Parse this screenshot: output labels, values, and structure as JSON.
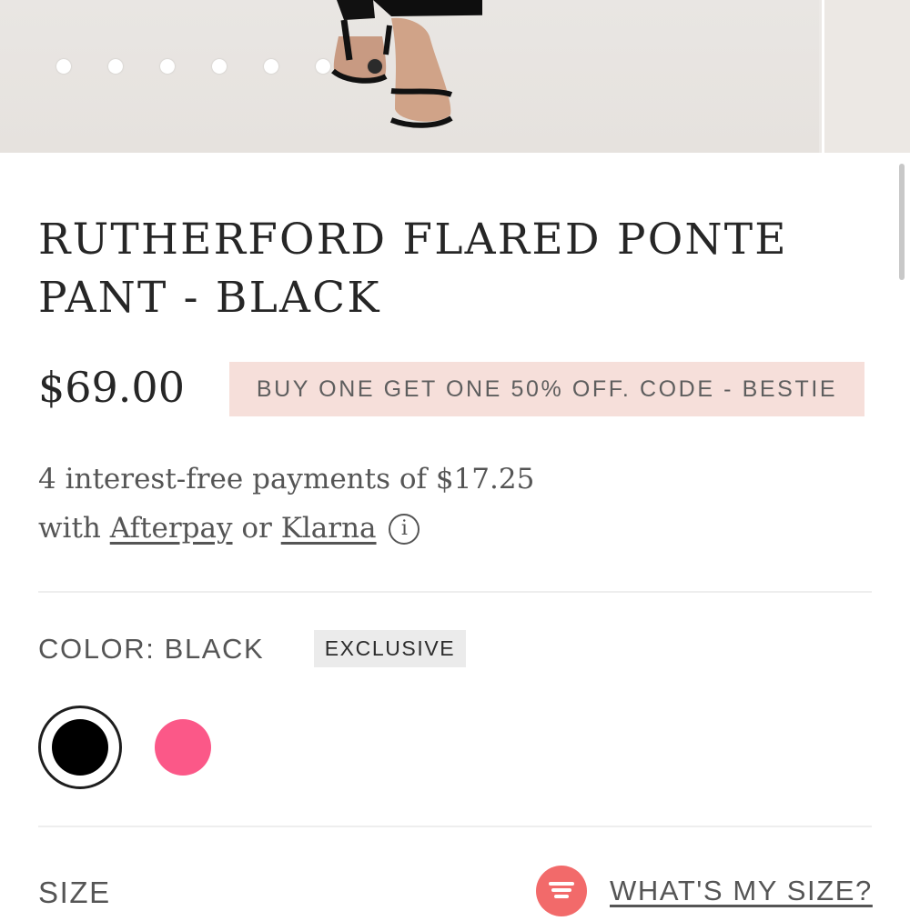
{
  "product": {
    "title": "RUTHERFORD FLARED PONTE PANT - BLACK",
    "price": "$69.00",
    "promo": "BUY ONE GET ONE 50% OFF. CODE - BESTIE"
  },
  "payments": {
    "line1": "4 interest-free payments of $17.25",
    "with": "with",
    "afterpay": "Afterpay",
    "or": "or",
    "klarna": "Klarna",
    "info_glyph": "i"
  },
  "color": {
    "label": "COLOR: BLACK",
    "badge": "EXCLUSIVE",
    "swatches": [
      {
        "name": "black",
        "hex": "#000000",
        "selected": true
      },
      {
        "name": "pink",
        "hex": "#fb5888",
        "selected": false
      }
    ]
  },
  "size": {
    "label": "SIZE",
    "link": "WHAT'S MY SIZE?",
    "icon": "size-guide-icon"
  },
  "gallery": {
    "dot_count": 7,
    "active_index": 6
  }
}
